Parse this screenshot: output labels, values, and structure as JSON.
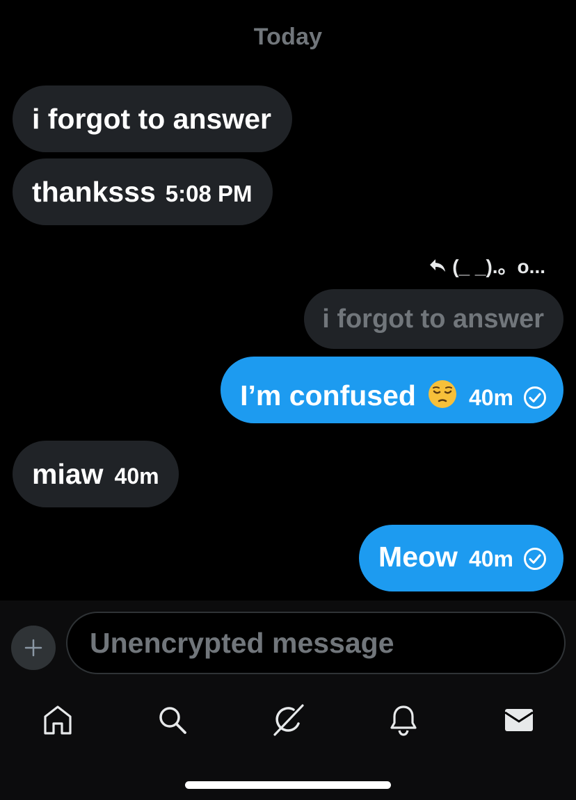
{
  "conversation": {
    "date_separator": "Today",
    "messages": [
      {
        "direction": "incoming",
        "text": "i forgot to answer",
        "time": ""
      },
      {
        "direction": "incoming",
        "text": "thanksss",
        "time": "5:08 PM"
      },
      {
        "direction": "outgoing",
        "reply_to_label": "(_ _).。o...",
        "quoted_text": "i forgot to answer",
        "text": "I’m confused",
        "emoji": "pensive-face",
        "time": "40m",
        "status": "sent-check"
      },
      {
        "direction": "incoming",
        "text": "miaw",
        "time": "40m"
      },
      {
        "direction": "outgoing",
        "text": "Meow",
        "time": "40m",
        "status": "sent-check"
      }
    ]
  },
  "composer": {
    "placeholder": "Unencrypted message",
    "add_icon": "plus-icon"
  },
  "tabbar": {
    "items": [
      {
        "icon": "home-icon",
        "active": false
      },
      {
        "icon": "search-icon",
        "active": false
      },
      {
        "icon": "grok-icon",
        "active": false
      },
      {
        "icon": "bell-icon",
        "active": false
      },
      {
        "icon": "mail-icon",
        "active": true
      }
    ]
  },
  "colors": {
    "background": "#000000",
    "incoming_bubble": "#202327",
    "outgoing_bubble": "#1d9bf0",
    "muted_text": "#71767b"
  }
}
